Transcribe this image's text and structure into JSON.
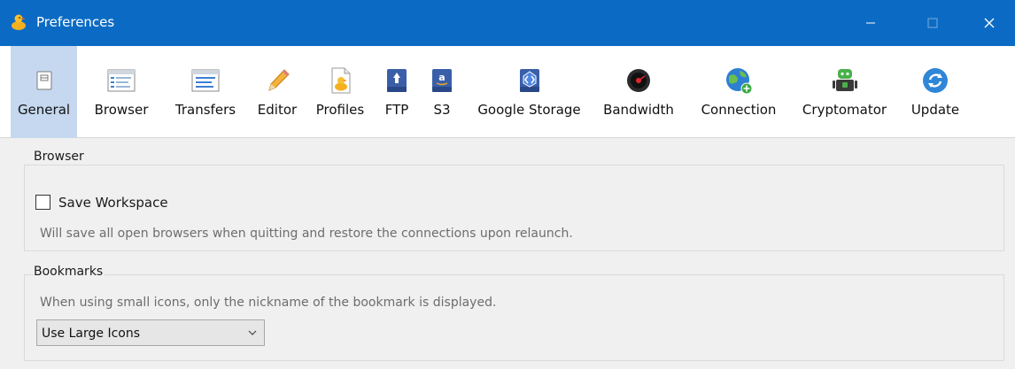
{
  "window": {
    "title": "Preferences"
  },
  "tabs": [
    {
      "id": "general",
      "label": "General",
      "icon": "general-icon"
    },
    {
      "id": "browser",
      "label": "Browser",
      "icon": "browser-window-icon"
    },
    {
      "id": "transfers",
      "label": "Transfers",
      "icon": "transfers-window-icon"
    },
    {
      "id": "editor",
      "label": "Editor",
      "icon": "pencil-icon"
    },
    {
      "id": "profiles",
      "label": "Profiles",
      "icon": "profile-document-icon"
    },
    {
      "id": "ftp",
      "label": "FTP",
      "icon": "ftp-drive-icon"
    },
    {
      "id": "s3",
      "label": "S3",
      "icon": "s3-drive-icon"
    },
    {
      "id": "google-storage",
      "label": "Google Storage",
      "icon": "google-storage-icon"
    },
    {
      "id": "bandwidth",
      "label": "Bandwidth",
      "icon": "bandwidth-gauge-icon"
    },
    {
      "id": "connection",
      "label": "Connection",
      "icon": "globe-plus-icon"
    },
    {
      "id": "cryptomator",
      "label": "Cryptomator",
      "icon": "cryptomator-robot-icon"
    },
    {
      "id": "update",
      "label": "Update",
      "icon": "refresh-icon"
    }
  ],
  "active_tab": "general",
  "browser": {
    "title": "Browser",
    "save_workspace_label": "Save Workspace",
    "save_workspace_checked": false,
    "description": "Will save all open browsers when quitting and restore the connections upon relaunch."
  },
  "bookmarks": {
    "title": "Bookmarks",
    "description": "When using small icons, only the nickname of the bookmark is displayed.",
    "icon_size_selected": "Use Large Icons"
  },
  "colors": {
    "titlebar": "#0b6bc4",
    "active_tab": "#c5d8ef",
    "toolbar_bg": "#ffffff",
    "panel_bg": "#f0f0f0"
  }
}
